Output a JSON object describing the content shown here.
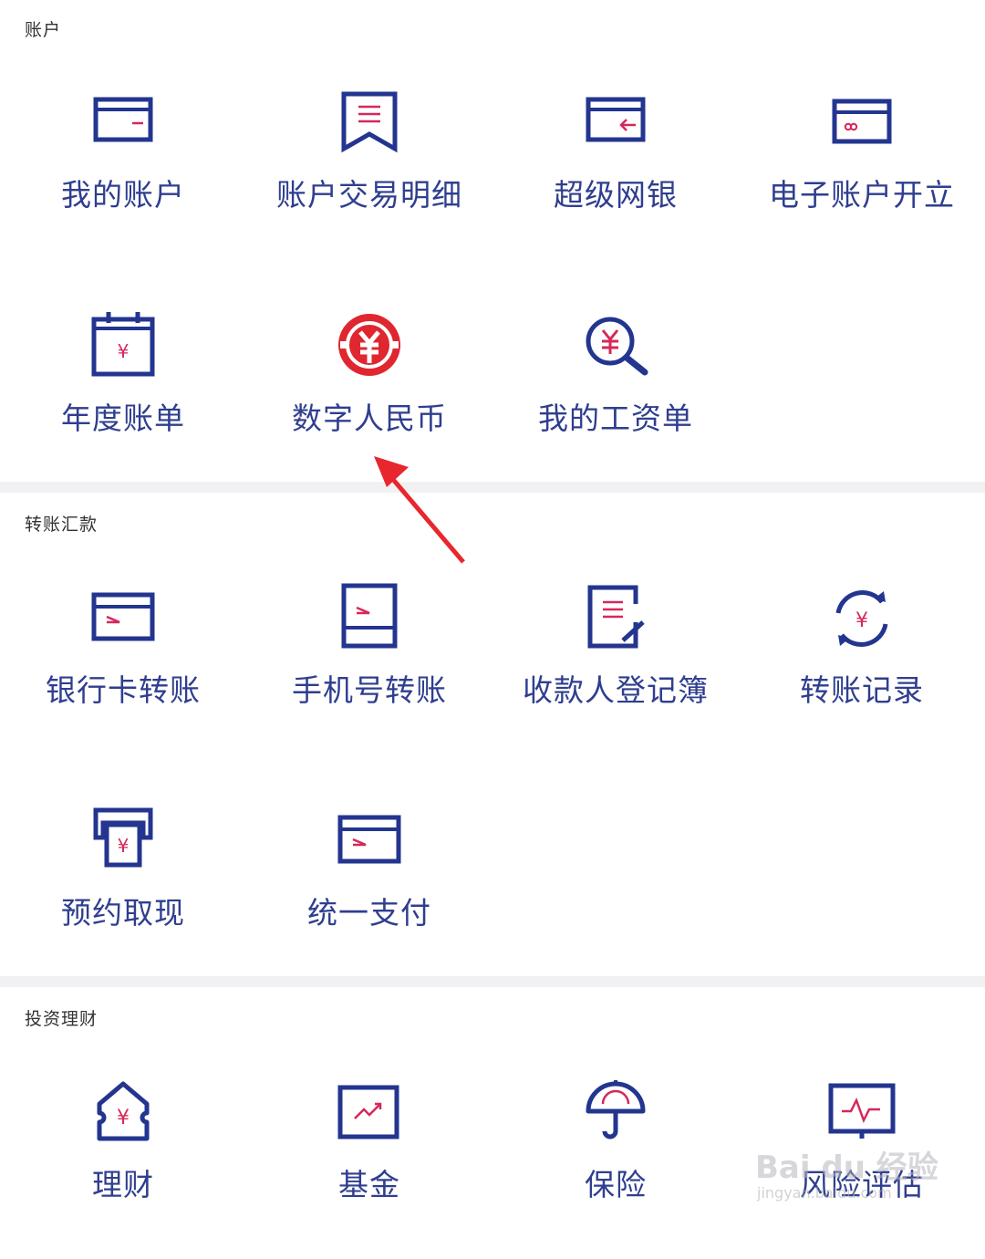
{
  "colors": {
    "primary": "#23358f",
    "accent": "#d6285a",
    "red": "#e0262f",
    "divider": "#f1f1f3"
  },
  "sections": {
    "account": {
      "title": "账户",
      "items": [
        {
          "label": "我的账户",
          "icon": "card-icon"
        },
        {
          "label": "账户交易明细",
          "icon": "receipt-icon"
        },
        {
          "label": "超级网银",
          "icon": "card-return-icon"
        },
        {
          "label": "电子账户开立",
          "icon": "card-link-icon"
        },
        {
          "label": "年度账单",
          "icon": "calendar-yuan-icon"
        },
        {
          "label": "数字人民币",
          "icon": "digital-rmb-icon"
        },
        {
          "label": "我的工资单",
          "icon": "yuan-search-icon"
        }
      ]
    },
    "transfer": {
      "title": "转账汇款",
      "items": [
        {
          "label": "银行卡转账",
          "icon": "card-transfer-icon"
        },
        {
          "label": "手机号转账",
          "icon": "phone-transfer-icon"
        },
        {
          "label": "收款人登记簿",
          "icon": "edit-note-icon"
        },
        {
          "label": "转账记录",
          "icon": "yuan-refresh-icon"
        },
        {
          "label": "预约取现",
          "icon": "atm-icon"
        },
        {
          "label": "统一支付",
          "icon": "card-pay-icon"
        }
      ]
    },
    "invest": {
      "title": "投资理财",
      "items": [
        {
          "label": "理财",
          "icon": "house-yuan-icon"
        },
        {
          "label": "基金",
          "icon": "chart-up-icon"
        },
        {
          "label": "保险",
          "icon": "umbrella-icon"
        },
        {
          "label": "风险评估",
          "icon": "monitor-pulse-icon"
        }
      ]
    }
  },
  "watermark": {
    "brand": "Bai du 经验",
    "url": "jingyan.baidu.com"
  }
}
